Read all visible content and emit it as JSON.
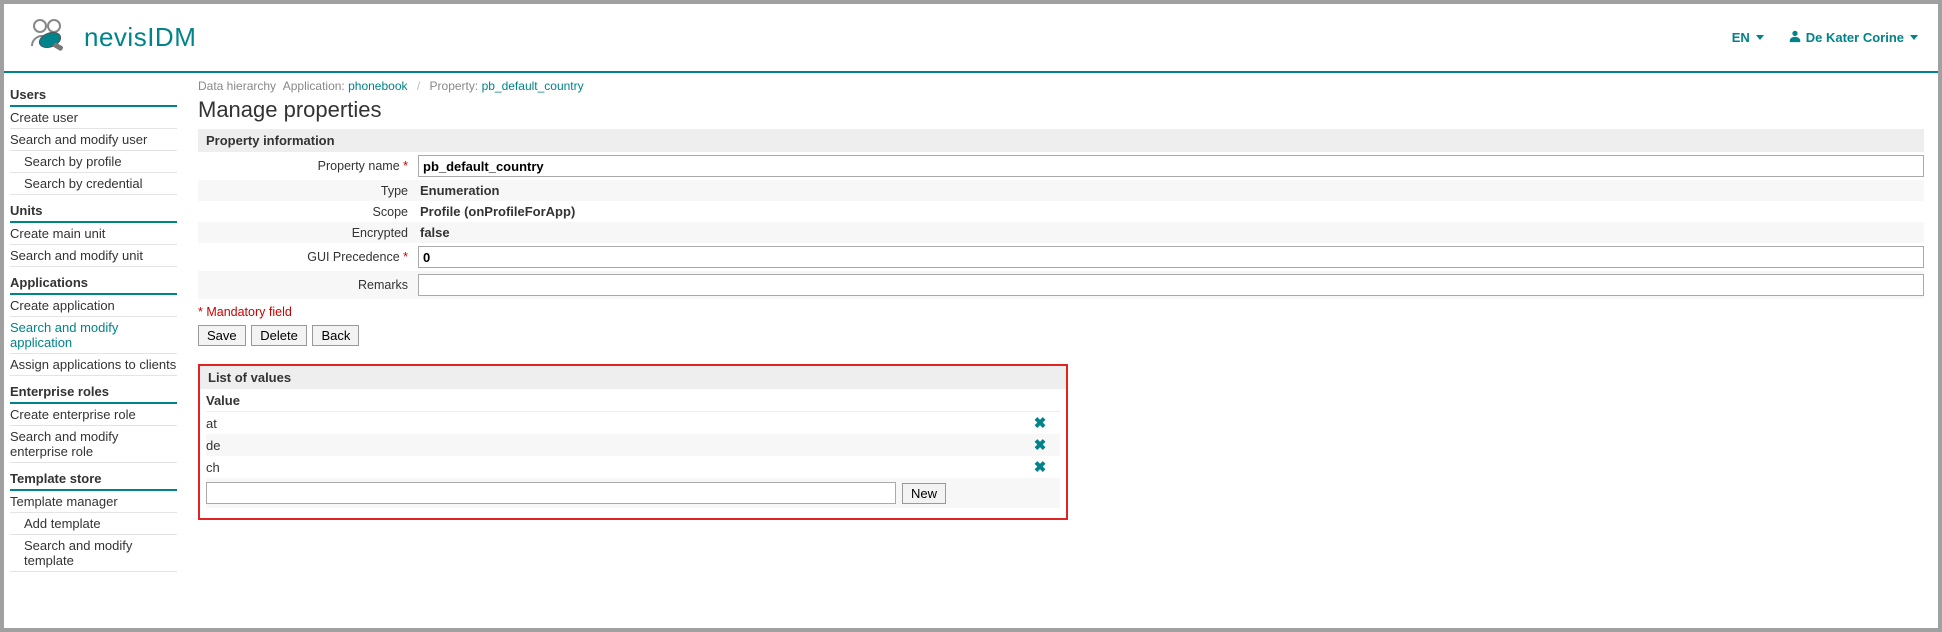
{
  "header": {
    "app_name": "nevisIDM",
    "language": "EN",
    "user_name": "De Kater Corine"
  },
  "sidebar": {
    "groups": [
      {
        "heading": "Users",
        "items": [
          {
            "label": "Create user",
            "sub": false,
            "active": false
          },
          {
            "label": "Search and modify user",
            "sub": false,
            "active": false
          },
          {
            "label": "Search by profile",
            "sub": true,
            "active": false
          },
          {
            "label": "Search by credential",
            "sub": true,
            "active": false
          }
        ]
      },
      {
        "heading": "Units",
        "items": [
          {
            "label": "Create main unit",
            "sub": false,
            "active": false
          },
          {
            "label": "Search and modify unit",
            "sub": false,
            "active": false
          }
        ]
      },
      {
        "heading": "Applications",
        "items": [
          {
            "label": "Create application",
            "sub": false,
            "active": false
          },
          {
            "label": "Search and modify application",
            "sub": false,
            "active": true
          },
          {
            "label": "Assign applications to clients",
            "sub": false,
            "active": false
          }
        ]
      },
      {
        "heading": "Enterprise roles",
        "items": [
          {
            "label": "Create enterprise role",
            "sub": false,
            "active": false
          },
          {
            "label": "Search and modify enterprise role",
            "sub": false,
            "active": false
          }
        ]
      },
      {
        "heading": "Template store",
        "items": [
          {
            "label": "Template manager",
            "sub": false,
            "active": false
          },
          {
            "label": "Add template",
            "sub": true,
            "active": false
          },
          {
            "label": "Search and modify template",
            "sub": true,
            "active": false
          }
        ]
      }
    ]
  },
  "breadcrumb": {
    "root": "Data hierarchy",
    "app_label": "Application:",
    "app_link": "phonebook",
    "prop_label": "Property:",
    "prop_link": "pb_default_country"
  },
  "page_title": "Manage properties",
  "form": {
    "section_title": "Property information",
    "labels": {
      "property_name": "Property name",
      "type": "Type",
      "scope": "Scope",
      "encrypted": "Encrypted",
      "gui_precedence": "GUI Precedence",
      "remarks": "Remarks"
    },
    "values": {
      "property_name": "pb_default_country",
      "type": "Enumeration",
      "scope": "Profile (onProfileForApp)",
      "encrypted": "false",
      "gui_precedence": "0",
      "remarks": ""
    },
    "mandatory_note": "* Mandatory field"
  },
  "buttons": {
    "save": "Save",
    "delete": "Delete",
    "back": "Back",
    "new": "New"
  },
  "values_list": {
    "heading": "List of values",
    "col_header": "Value",
    "rows": [
      "at",
      "de",
      "ch"
    ],
    "new_value": ""
  }
}
